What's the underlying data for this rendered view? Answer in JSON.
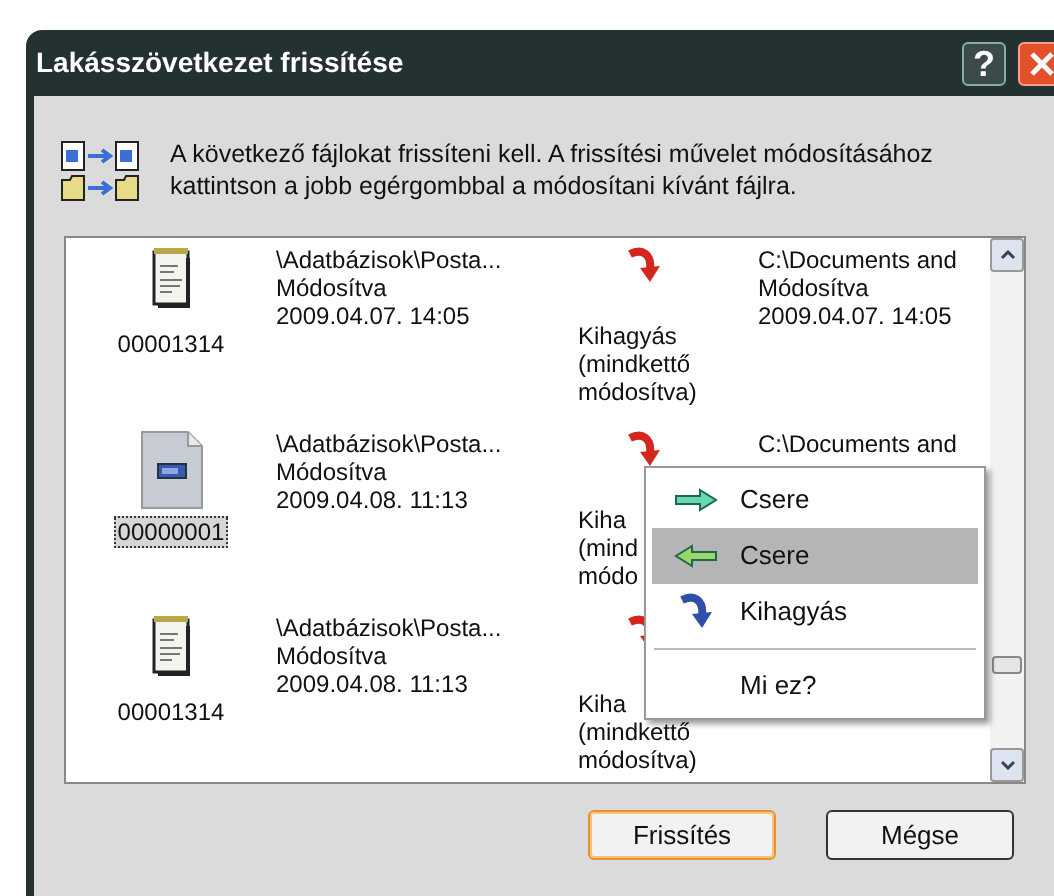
{
  "window": {
    "title": "Lakásszövetkezet frissítése",
    "help": "?"
  },
  "message": "A következő fájlokat frissíteni kell. A frissítési művelet módosításához kattintson a jobb egérgombbal a módosítani kívánt fájlra.",
  "files": [
    {
      "kind": "notepad",
      "name": "00001314",
      "selected": false,
      "source": [
        "\\Adatbázisok\\Posta...",
        "Módosítva",
        "2009.04.07. 14:05"
      ],
      "action": [
        "Kihagyás",
        "(mindkettő",
        "módosítva)"
      ],
      "target": [
        "C:\\Documents and",
        "Módosítva",
        "2009.04.07. 14:05"
      ]
    },
    {
      "kind": "document",
      "name": "00000001",
      "selected": true,
      "source": [
        "\\Adatbázisok\\Posta...",
        "Módosítva",
        "2009.04.08. 11:13"
      ],
      "action": [
        "Kiha",
        "(mind",
        "módo"
      ],
      "target": [
        "C:\\Documents and"
      ]
    },
    {
      "kind": "notepad",
      "name": "00001314",
      "selected": false,
      "source": [
        "\\Adatbázisok\\Posta...",
        "Módosítva",
        "2009.04.08. 11:13"
      ],
      "action": [
        "Kiha",
        "(mindkettő",
        "módosítva)"
      ]
    }
  ],
  "context_menu": [
    {
      "kind": "replace-right",
      "label": "Csere",
      "selected": false
    },
    {
      "kind": "replace-left",
      "label": "Csere",
      "selected": true
    },
    {
      "kind": "skip",
      "label": "Kihagyás",
      "selected": false
    },
    {
      "kind": "separator"
    },
    {
      "kind": "help",
      "label": "Mi ez?",
      "selected": false
    }
  ],
  "buttons": [
    {
      "label": "Frissítés",
      "default": true
    },
    {
      "label": "Mégse",
      "default": false
    }
  ]
}
